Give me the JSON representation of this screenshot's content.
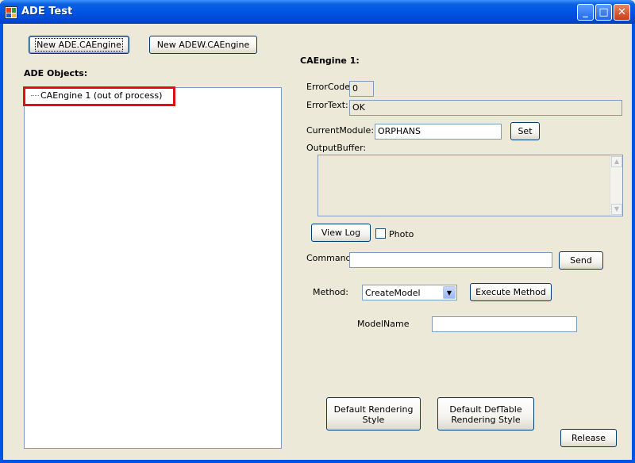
{
  "window": {
    "title": "ADE Test",
    "minimize_glyph": "_",
    "maximize_glyph": "□",
    "close_glyph": "✕"
  },
  "toolbar": {
    "new_ade_label": "New ADE.CAEngine",
    "new_adew_label": "New ADEW.CAEngine"
  },
  "objects": {
    "heading": "ADE Objects:",
    "items": [
      {
        "label": "CAEngine 1 (out of process)",
        "selected": true
      }
    ]
  },
  "engine": {
    "heading": "CAEngine 1:",
    "error_code_label": "ErrorCode",
    "error_code_value": "0",
    "error_text_label": "ErrorText:",
    "error_text_value": "OK",
    "current_module_label": "CurrentModule:",
    "current_module_value": "ORPHANS",
    "set_label": "Set",
    "output_buffer_label": "OutputBuffer:",
    "output_buffer_value": "",
    "scroll_up_glyph": "▲",
    "scroll_down_glyph": "▼",
    "view_log_label": "View Log",
    "photo_label": "Photo",
    "photo_checked": false,
    "command_label": "Command:",
    "command_value": "",
    "send_label": "Send",
    "method_label": "Method:",
    "method_value": "CreateModel",
    "dropdown_glyph": "▼",
    "execute_label": "Execute Method",
    "model_name_label": "ModelName",
    "model_name_value": "",
    "default_rendering_line1": "Default Rendering",
    "default_rendering_line2": "Style",
    "default_deftable_line1": "Default DefTable",
    "default_deftable_line2": "Rendering Style",
    "release_label": "Release"
  },
  "colors": {
    "titlebar": "#0055e5",
    "highlight_border": "#e0101a",
    "window_bg": "#ece9d8"
  },
  "icons": {
    "app": "app-icon",
    "minimize": "minimize-icon",
    "maximize": "maximize-icon",
    "close": "close-icon"
  }
}
